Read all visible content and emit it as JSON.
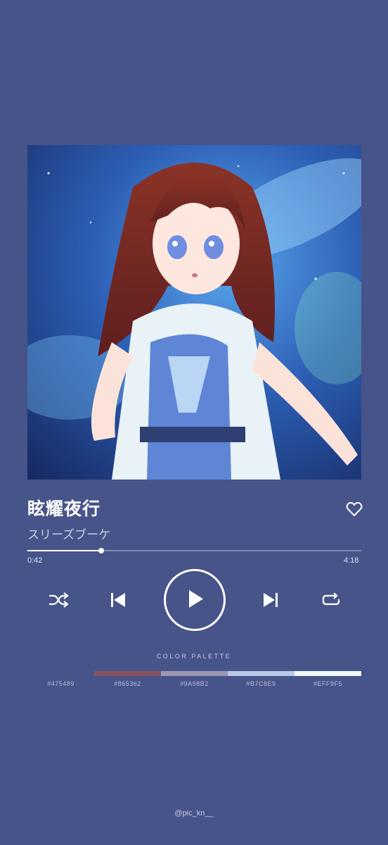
{
  "song": {
    "title": "眩耀夜行",
    "artist": "スリーズブーケ"
  },
  "progress": {
    "current": "0:42",
    "total": "4:18",
    "fraction": 0.22
  },
  "controls": {
    "shuffle_icon": "shuffle-icon",
    "previous_icon": "skip-previous-icon",
    "play_icon": "play-icon",
    "next_icon": "skip-next-icon",
    "repeat_icon": "repeat-icon",
    "like_icon": "heart-icon"
  },
  "palette": {
    "title": "COLOR PALETTE",
    "swatches": [
      {
        "hex": "#475489",
        "label": "#475489"
      },
      {
        "hex": "#865362",
        "label": "#865362"
      },
      {
        "hex": "#9A98B2",
        "label": "#9A98B2"
      },
      {
        "hex": "#B7C8E9",
        "label": "#B7C8E9"
      },
      {
        "hex": "#EFF9F5",
        "label": "#EFF9F5"
      }
    ]
  },
  "credit": "@pic_kn__",
  "colors": {
    "background": "#475489",
    "accent": "#ffffff"
  }
}
